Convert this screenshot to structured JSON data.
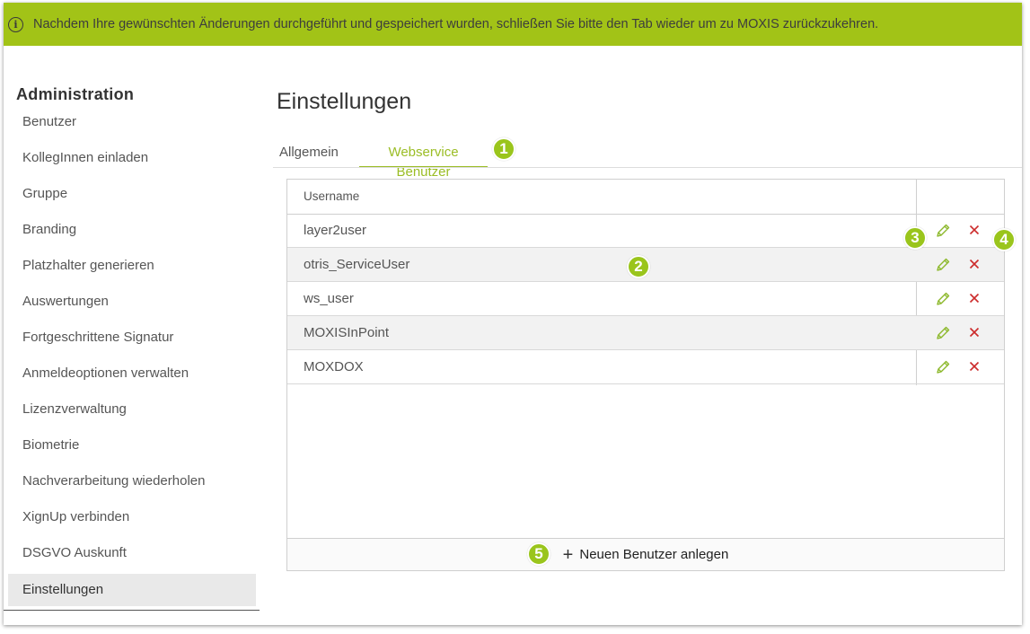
{
  "banner": {
    "icon": "info-icon",
    "message": "Nachdem Ihre gewünschten Änderungen durchgeführt und gespeichert wurden, schließen Sie bitte den Tab wieder um zu MOXIS zurückzukehren."
  },
  "sidebar": {
    "title": "Administration",
    "items": [
      {
        "label": "Benutzer"
      },
      {
        "label": "KollegInnen einladen"
      },
      {
        "label": "Gruppe"
      },
      {
        "label": "Branding"
      },
      {
        "label": "Platzhalter generieren"
      },
      {
        "label": "Auswertungen"
      },
      {
        "label": "Fortgeschrittene Signatur"
      },
      {
        "label": "Anmeldeoptionen verwalten"
      },
      {
        "label": "Lizenzverwaltung"
      },
      {
        "label": "Biometrie"
      },
      {
        "label": "Nachverarbeitung wiederholen"
      },
      {
        "label": "XignUp verbinden"
      },
      {
        "label": "DSGVO Auskunft"
      },
      {
        "label": "Einstellungen",
        "active": true
      }
    ]
  },
  "main": {
    "title": "Einstellungen",
    "tabs": [
      {
        "label": "Allgemein"
      },
      {
        "label": "Webservice Benutzer",
        "active": true
      }
    ],
    "table": {
      "column_header": "Username",
      "rows": [
        {
          "username": "layer2user"
        },
        {
          "username": "otris_ServiceUser"
        },
        {
          "username": "ws_user"
        },
        {
          "username": "MOXISInPoint"
        },
        {
          "username": "MOXDOX"
        }
      ]
    },
    "add_button": {
      "icon": "plus-icon",
      "label": "Neuen Benutzer anlegen"
    }
  },
  "callouts": [
    "1",
    "2",
    "3",
    "4",
    "5"
  ],
  "colors": {
    "banner": "#a2c317",
    "accent": "#9bbd25",
    "badge": "#9ac51c",
    "edit_icon": "#8cb82b",
    "delete_icon": "#cc2b2b",
    "active_sidebar_bg": "#e9e9e9"
  }
}
